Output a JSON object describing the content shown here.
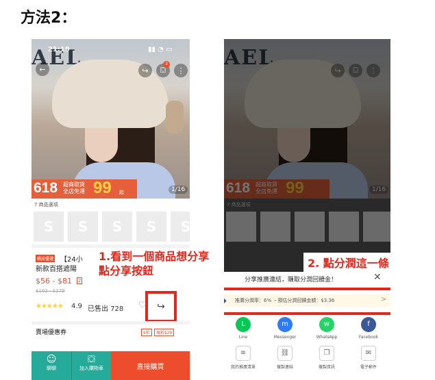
{
  "title": "方法2：",
  "left": {
    "status_time": "21:19",
    "status_icons": "▮▮ ◔ ▭",
    "shop_sign": "AEL",
    "back_icon": "←",
    "share_icon": "↪",
    "cart_icon": "⛋",
    "cart_badge": "3",
    "more_icon": "⋮",
    "banner_618": "618",
    "banner_line1": "超商取貨",
    "banner_line2": "全店免運",
    "banner_99": "99",
    "banner_qi": "起",
    "image_counter": "1/16",
    "options_label": "7 商品選項",
    "thumb_glyph": "S",
    "tag": "蝦皮優選",
    "name_line1": "【24小",
    "name_line2": "新款百搭遮陽",
    "price": "$56 - $81",
    "price_badge": "2",
    "old_price": "$193 - $279",
    "stars": "★★★★★",
    "rating": "4.9",
    "sold": "已售出 728",
    "heart_icon": "♡",
    "share_btn_icon": "↪",
    "shop_promo": "賣場優惠券",
    "promo_tag1": "9折",
    "promo_tag2": "現折$20",
    "chat_icon": "☺",
    "chat_label": "聊聊",
    "cart_btn_icon": "⛋",
    "cart_label": "加入購物車",
    "buy_label": "直接購買"
  },
  "annotation1_line1": "1.看到一個商品想分享",
  "annotation1_line2": "點分享按鈕",
  "right": {
    "sheet_title": "分享推廣連結，賺取分潤回饋金！",
    "close_icon": "✕",
    "rate_icon": "◆",
    "rate_text": "推廣分潤率：6% ・預估分潤回饋金額：$3.36",
    "rate_arrow": ">",
    "apps": [
      {
        "label": "Line",
        "glyph": "L",
        "color": "#06c755"
      },
      {
        "label": "Messenger",
        "glyph": "m",
        "color": "#2d7cf6"
      },
      {
        "label": "WhatsApp",
        "glyph": "w",
        "color": "#25d366"
      },
      {
        "label": "Facebook",
        "glyph": "f",
        "color": "#3b5998"
      }
    ],
    "actions": [
      {
        "label": "我的推廣清單",
        "glyph": "≡"
      },
      {
        "label": "複製連結",
        "glyph": "⛓"
      },
      {
        "label": "複製資訊",
        "glyph": "❐"
      },
      {
        "label": "電子郵件",
        "glyph": "✉"
      }
    ]
  },
  "annotation2": "2. 點分潤這一條"
}
